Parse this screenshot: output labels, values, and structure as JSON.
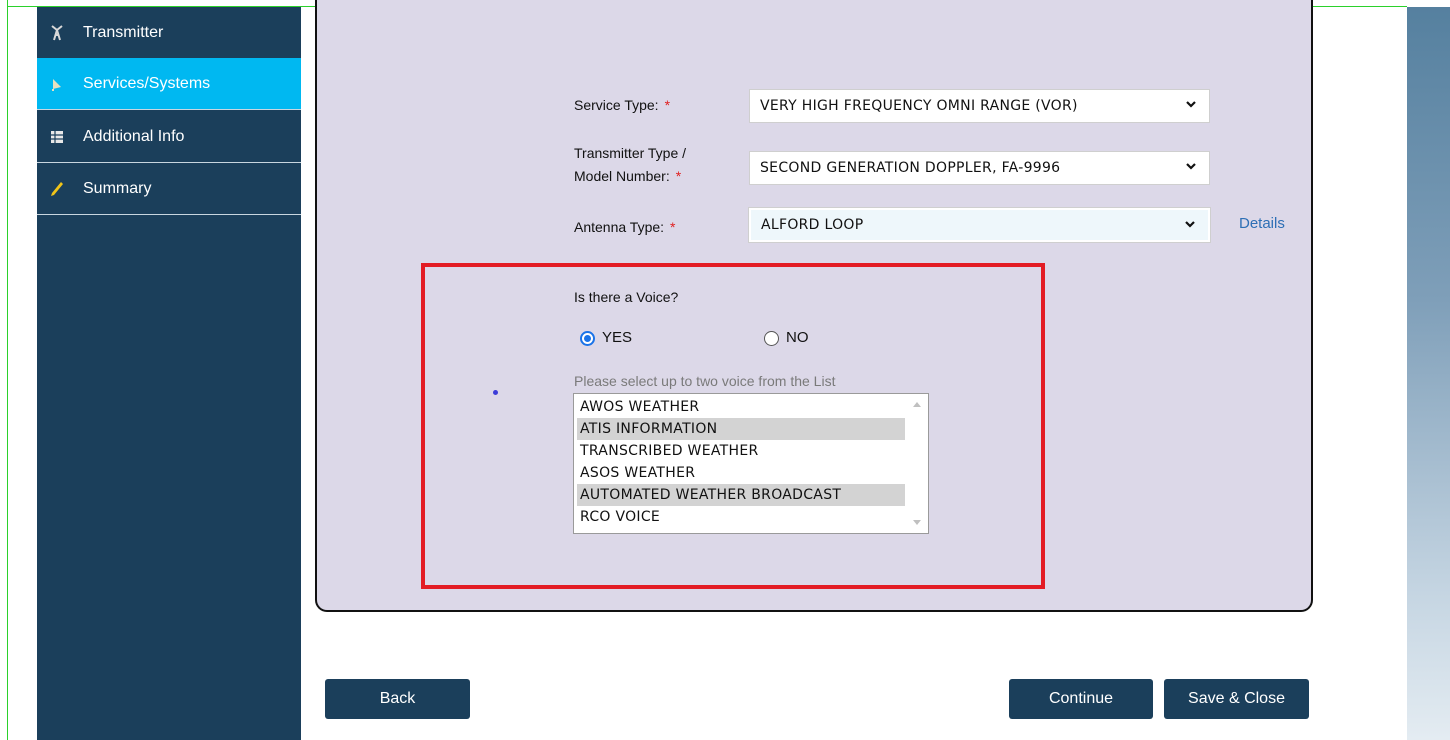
{
  "sidebar": {
    "items": [
      {
        "label": "Transmitter",
        "icon": "tower-icon",
        "active": false
      },
      {
        "label": "Services/Systems",
        "icon": "satellite-dish-icon",
        "active": true
      },
      {
        "label": "Additional Info",
        "icon": "table-icon",
        "active": false
      },
      {
        "label": "Summary",
        "icon": "pencil-icon",
        "active": false
      }
    ]
  },
  "form": {
    "service_type": {
      "label": "Service Type:",
      "value": "VERY HIGH FREQUENCY OMNI RANGE (VOR)"
    },
    "transmitter_type": {
      "label_line1": "Transmitter Type /",
      "label_line2": "Model Number:",
      "value": "SECOND GENERATION DOPPLER, FA-9996"
    },
    "antenna_type": {
      "label": "Antenna Type:",
      "value": "ALFORD LOOP"
    },
    "required_marker": "*",
    "details_link": "Details"
  },
  "voice": {
    "question": "Is there a Voice?",
    "yes_label": "YES",
    "no_label": "NO",
    "selected": "YES",
    "list_hint": "Please select up to two voice from the List",
    "options": [
      {
        "label": "AWOS WEATHER",
        "selected": false
      },
      {
        "label": "ATIS INFORMATION",
        "selected": true
      },
      {
        "label": "TRANSCRIBED WEATHER",
        "selected": false
      },
      {
        "label": "ASOS WEATHER",
        "selected": false
      },
      {
        "label": "AUTOMATED WEATHER BROADCAST",
        "selected": true
      },
      {
        "label": "RCO VOICE",
        "selected": false
      }
    ]
  },
  "buttons": {
    "back": "Back",
    "continue": "Continue",
    "save_close": "Save & Close"
  },
  "colors": {
    "sidebar_bg": "#1b3f5b",
    "active_item": "#00b8f1",
    "panel_bg": "#dcd8e8",
    "highlight_border": "#e31c24",
    "link": "#2d6fb5"
  }
}
